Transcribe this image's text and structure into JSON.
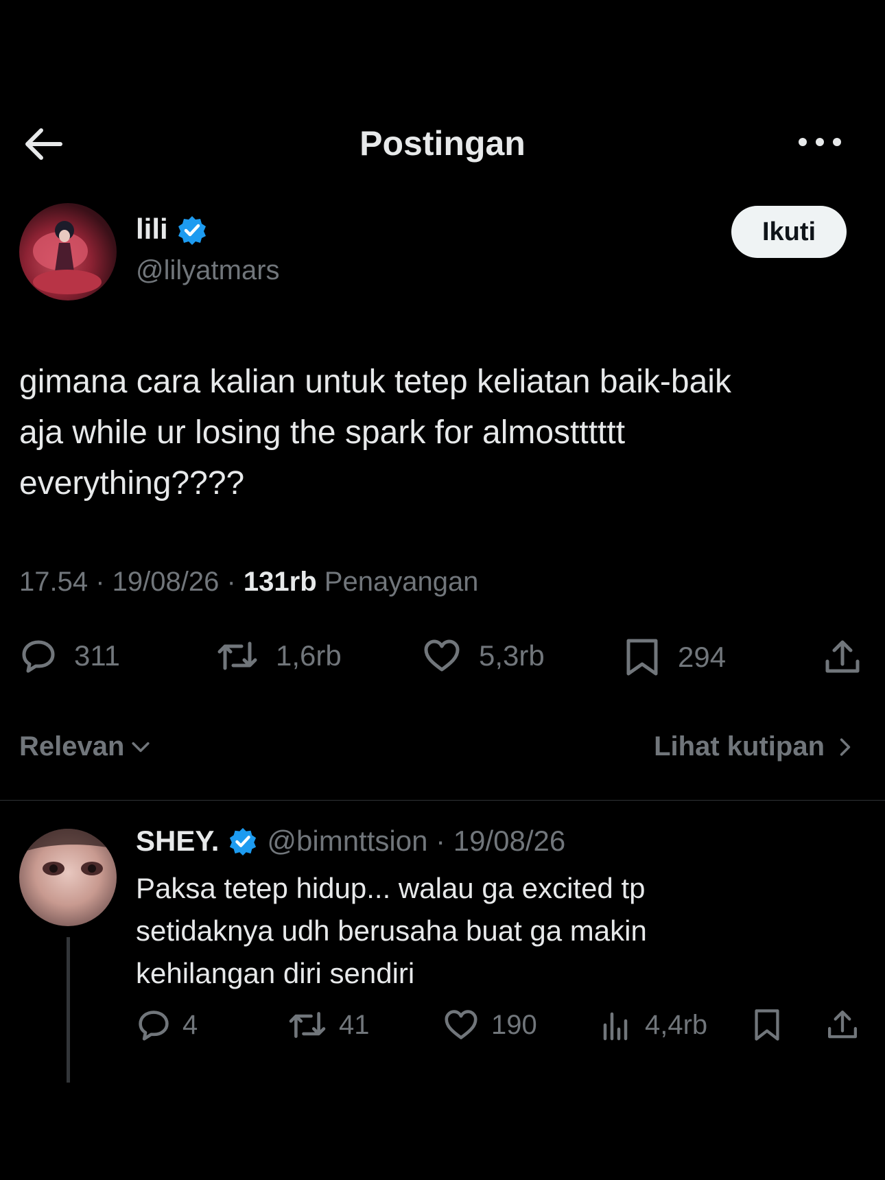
{
  "header": {
    "title": "Postingan",
    "back_icon": "arrow-left-icon",
    "more_icon": "more-horizontal-icon"
  },
  "post": {
    "author": {
      "name": "lili",
      "handle": "@lilyatmars",
      "verified": true
    },
    "follow_label": "Ikuti",
    "text": "gimana cara kalian untuk tetep keliatan baik-baik\naja while ur losing the spark for almostttttt\neverything????",
    "time": "17.54",
    "date": "19/08/26",
    "views_count": "131rb",
    "views_label": "Penayangan",
    "stats": {
      "replies": "311",
      "reposts": "1,6rb",
      "likes": "5,3rb",
      "bookmarks": "294"
    }
  },
  "sort": {
    "label": "Relevan",
    "quotes_label": "Lihat kutipan"
  },
  "reply": {
    "name": "SHEY.",
    "handle": "@bimnttsion",
    "date": "19/08/26",
    "verified": true,
    "text": "Paksa tetep hidup... walau ga excited tp\nsetidaknya udh berusaha buat ga makin\nkehilangan diri sendiri",
    "stats": {
      "replies": "4",
      "reposts": "41",
      "likes": "190",
      "views": "4,4rb"
    }
  },
  "colors": {
    "background": "#000000",
    "text_primary": "#e7e9ea",
    "text_secondary": "#71767b",
    "verified_blue": "#1d9bf0",
    "follow_bg": "#eff3f4"
  }
}
